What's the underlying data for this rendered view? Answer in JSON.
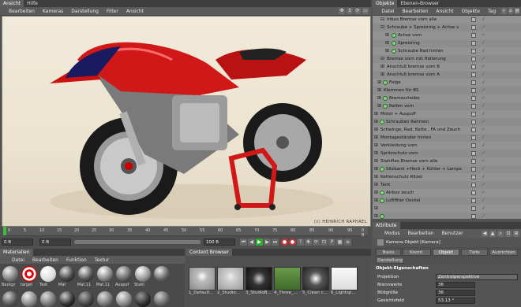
{
  "viewport": {
    "tabs": [
      "Ansicht",
      "Hilfe"
    ],
    "menu": [
      "Bearbeiten",
      "Kameras",
      "Darstellung",
      "Filter",
      "Ansicht"
    ],
    "watermark": "(c) HEINRICH RAPHAEL"
  },
  "timeline": {
    "ticks": [
      "0",
      "5",
      "10",
      "15",
      "20",
      "25",
      "30",
      "35",
      "40",
      "45",
      "50",
      "55",
      "60",
      "65",
      "70",
      "75",
      "80",
      "85",
      "90",
      "95"
    ],
    "end_marker": "0 B",
    "start_frame": "0 B",
    "preview_start": "0 B",
    "end_frame": "100 B"
  },
  "materials": {
    "tab": "Materialien",
    "menu": [
      "Datei",
      "Bearbeiten",
      "Funktion",
      "Textur"
    ],
    "items": [
      "Backgr",
      "target",
      "Text",
      "Mat",
      "Mat.11",
      "Mat.11",
      "Auspuf",
      "Stahl",
      ""
    ]
  },
  "content_browser": {
    "tab": "Content Browser",
    "items": [
      "1_Default...",
      "2_Studio...",
      "3_StudioB...",
      "4_Three_...",
      "5_Clean c...",
      "6_Lightsp..."
    ]
  },
  "objects": {
    "tabs": [
      "Objekte",
      "Ebenen-Browser"
    ],
    "menu": [
      "Datei",
      "Bearbeiten",
      "Ansicht",
      "Objekte",
      "Tag"
    ],
    "rows": [
      "Inbus Bremse vorn alle",
      "Schraube + Spreizring + Achse v",
      "Achse vorn",
      "Spreizring",
      "Schraube Rad hinten",
      "Bremse vorn mit Halterung",
      "Anschluß bremse vorn B",
      "Anschluß bremse vorn A",
      "Felge",
      "Klemmen für BS",
      "Bremsscheibe",
      "Reifen vorn",
      "Motor + Auspuff",
      "Schrauben Rahmen",
      "Schwinge, Rad, Kette , FA und Zeuch",
      "Montageständer hinten",
      "Verkleidung vorn",
      "Spritzschutz vorn",
      "Stahlflex Bremse vorn alle",
      "Sitzbank +Heck + Kühler + Lampe",
      "Kettenschutz Ritzel",
      "Tank",
      "Airbox zeuch",
      "Luftfilter Deckel",
      "",
      ""
    ]
  },
  "attributes": {
    "tab": "Attribute",
    "menu": [
      "Modus",
      "Bearbeiten",
      "Benutzer"
    ],
    "title": "Kamera-Objekt [Kamera]",
    "tabs": [
      "Basis",
      "Koord.",
      "Objekt",
      "Tiefe",
      "Ausrichten",
      "Darstellung"
    ],
    "section_title": "Objekt-Eigenschaften",
    "props": [
      {
        "label": "Projektion",
        "value": "Zentralperspektive"
      },
      {
        "label": "Brennweite",
        "value": "36"
      },
      {
        "label": "Bildgröße",
        "value": "36"
      },
      {
        "label": "Gesichtsfeld",
        "value": "53.13 °"
      }
    ]
  }
}
